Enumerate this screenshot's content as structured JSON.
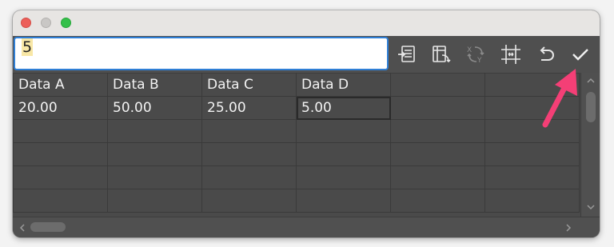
{
  "window": {
    "traffic_lights": [
      "close",
      "minimize",
      "maximize"
    ]
  },
  "toolbar": {
    "value_input": "5",
    "icons": [
      "import-data-icon",
      "transpose-icon",
      "swap-xy-icon",
      "cell-style-icon",
      "revert-icon",
      "apply-checkmark-icon"
    ]
  },
  "grid": {
    "rows": [
      [
        "Data A",
        "Data B",
        "Data C",
        "Data D",
        "",
        ""
      ],
      [
        "20.00",
        "50.00",
        "25.00",
        "5.00",
        "",
        ""
      ],
      [
        "",
        "",
        "",
        "",
        "",
        ""
      ],
      [
        "",
        "",
        "",
        "",
        "",
        ""
      ],
      [
        "",
        "",
        "",
        "",
        "",
        ""
      ],
      [
        "",
        "",
        "",
        "",
        "",
        ""
      ]
    ],
    "selected_cell": "Data D / 5.00"
  },
  "colors": {
    "accent_blue": "#2f7fd6",
    "grid_bg": "#4a4a4a",
    "annotation_arrow": "#f43f76"
  }
}
